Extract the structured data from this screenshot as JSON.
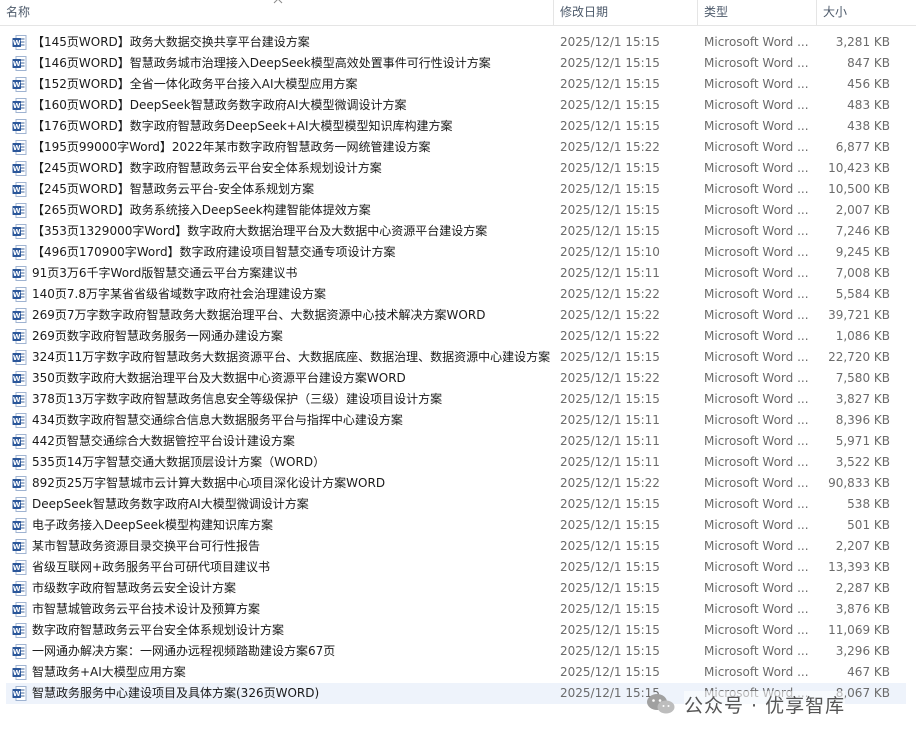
{
  "header": {
    "name_label": "名称",
    "date_label": "修改日期",
    "type_label": "类型",
    "size_label": "大小"
  },
  "files": [
    {
      "name": "【145页WORD】政务大数据交换共享平台建设方案",
      "date": "2025/12/1 15:15",
      "type": "Microsoft Word ...",
      "size": "3,281 KB"
    },
    {
      "name": "【146页WORD】智慧政务城市治理接入DeepSeek模型高效处置事件可行性设计方案",
      "date": "2025/12/1 15:15",
      "type": "Microsoft Word ...",
      "size": "847 KB"
    },
    {
      "name": "【152页WORD】全省一体化政务平台接入AI大模型应用方案",
      "date": "2025/12/1 15:15",
      "type": "Microsoft Word ...",
      "size": "456 KB"
    },
    {
      "name": "【160页WORD】DeepSeek智慧政务数字政府AI大模型微调设计方案",
      "date": "2025/12/1 15:15",
      "type": "Microsoft Word ...",
      "size": "483 KB"
    },
    {
      "name": "【176页WORD】数字政府智慧政务DeepSeek+AI大模型模型知识库构建方案",
      "date": "2025/12/1 15:15",
      "type": "Microsoft Word ...",
      "size": "438 KB"
    },
    {
      "name": "【195页99000字Word】2022年某市数字政府智慧政务一网统管建设方案",
      "date": "2025/12/1 15:22",
      "type": "Microsoft Word ...",
      "size": "6,877 KB"
    },
    {
      "name": "【245页WORD】数字政府智慧政务云平台安全体系规划设计方案",
      "date": "2025/12/1 15:15",
      "type": "Microsoft Word ...",
      "size": "10,423 KB"
    },
    {
      "name": "【245页WORD】智慧政务云平台-安全体系规划方案",
      "date": "2025/12/1 15:15",
      "type": "Microsoft Word ...",
      "size": "10,500 KB"
    },
    {
      "name": "【265页WORD】政务系统接入DeepSeek构建智能体提效方案",
      "date": "2025/12/1 15:15",
      "type": "Microsoft Word ...",
      "size": "2,007 KB"
    },
    {
      "name": "【353页1329000字Word】数字政府大数据治理平台及大数据中心资源平台建设方案",
      "date": "2025/12/1 15:15",
      "type": "Microsoft Word ...",
      "size": "7,246 KB"
    },
    {
      "name": "【496页170900字Word】数字政府建设项目智慧交通专项设计方案",
      "date": "2025/12/1 15:10",
      "type": "Microsoft Word ...",
      "size": "9,245 KB"
    },
    {
      "name": "91页3万6千字Word版智慧交通云平台方案建议书",
      "date": "2025/12/1 15:11",
      "type": "Microsoft Word ...",
      "size": "7,008 KB"
    },
    {
      "name": "140页7.8万字某省省级省域数字政府社会治理建设方案",
      "date": "2025/12/1 15:22",
      "type": "Microsoft Word ...",
      "size": "5,584 KB"
    },
    {
      "name": "269页7万字数字政府智慧政务大数据治理平台、大数据资源中心技术解决方案WORD",
      "date": "2025/12/1 15:22",
      "type": "Microsoft Word ...",
      "size": "39,721 KB"
    },
    {
      "name": "269页数字政府智慧政务服务一网通办建设方案",
      "date": "2025/12/1 15:22",
      "type": "Microsoft Word ...",
      "size": "1,086 KB"
    },
    {
      "name": "324页11万字数字政府智慧政务大数据资源平台、大数据底座、数据治理、数据资源中心建设方案",
      "date": "2025/12/1 15:15",
      "type": "Microsoft Word ...",
      "size": "22,720 KB"
    },
    {
      "name": "350页数字政府大数据治理平台及大数据中心资源平台建设方案WORD",
      "date": "2025/12/1 15:22",
      "type": "Microsoft Word ...",
      "size": "7,580 KB"
    },
    {
      "name": "378页13万字数字政府智慧政务信息安全等级保护（三级）建设项目设计方案",
      "date": "2025/12/1 15:15",
      "type": "Microsoft Word ...",
      "size": "3,827 KB"
    },
    {
      "name": "434页数字政府智慧交通综合信息大数据服务平台与指挥中心建设方案",
      "date": "2025/12/1 15:11",
      "type": "Microsoft Word ...",
      "size": "8,396 KB"
    },
    {
      "name": "442页智慧交通综合大数据管控平台设计建设方案",
      "date": "2025/12/1 15:11",
      "type": "Microsoft Word ...",
      "size": "5,971 KB"
    },
    {
      "name": "535页14万字智慧交通大数据顶层设计方案（WORD）",
      "date": "2025/12/1 15:11",
      "type": "Microsoft Word ...",
      "size": "3,522 KB"
    },
    {
      "name": "892页25万字智慧城市云计算大数据中心项目深化设计方案WORD",
      "date": "2025/12/1 15:22",
      "type": "Microsoft Word ...",
      "size": "90,833 KB"
    },
    {
      "name": "DeepSeek智慧政务数字政府AI大模型微调设计方案",
      "date": "2025/12/1 15:15",
      "type": "Microsoft Word ...",
      "size": "538 KB"
    },
    {
      "name": "电子政务接入DeepSeek模型构建知识库方案",
      "date": "2025/12/1 15:15",
      "type": "Microsoft Word ...",
      "size": "501 KB"
    },
    {
      "name": "某市智慧政务资源目录交换平台可行性报告",
      "date": "2025/12/1 15:15",
      "type": "Microsoft Word ...",
      "size": "2,207 KB"
    },
    {
      "name": "省级互联网+政务服务平台可研代项目建议书",
      "date": "2025/12/1 15:15",
      "type": "Microsoft Word ...",
      "size": "13,393 KB"
    },
    {
      "name": "市级数字政府智慧政务云安全设计方案",
      "date": "2025/12/1 15:15",
      "type": "Microsoft Word ...",
      "size": "2,287 KB"
    },
    {
      "name": "市智慧城管政务云平台技术设计及预算方案",
      "date": "2025/12/1 15:15",
      "type": "Microsoft Word ...",
      "size": "3,876 KB"
    },
    {
      "name": "数字政府智慧政务云平台安全体系规划设计方案",
      "date": "2025/12/1 15:15",
      "type": "Microsoft Word ...",
      "size": "11,069 KB"
    },
    {
      "name": "一网通办解决方案：一网通办远程视频踏勘建设方案67页",
      "date": "2025/12/1 15:15",
      "type": "Microsoft Word ...",
      "size": "3,296 KB"
    },
    {
      "name": "智慧政务+AI大模型应用方案",
      "date": "2025/12/1 15:15",
      "type": "Microsoft Word ...",
      "size": "467 KB"
    },
    {
      "name": "智慧政务服务中心建设项目及具体方案(326页WORD)",
      "date": "2025/12/1 15:15",
      "type": "Microsoft Word ...",
      "size": "8,067 KB"
    }
  ],
  "selected_index": 31,
  "watermark": {
    "text": "公众号 · 优享智库"
  },
  "icons": {
    "file_icon": "word-document-icon",
    "sort_icon": "sort-ascending-chevron-icon"
  },
  "colors": {
    "word_blue": "#2b579a",
    "selection": "#eef3fb",
    "header_text": "#4d5a6b",
    "secondary_text": "#6b6b6b"
  }
}
